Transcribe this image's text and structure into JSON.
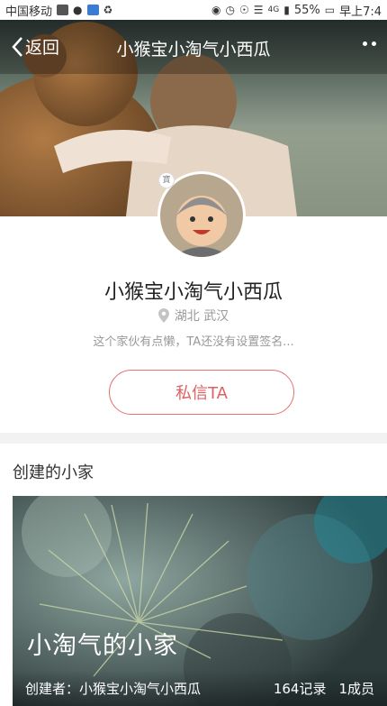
{
  "status_bar": {
    "carrier": "中国移动",
    "network": "4G",
    "battery": "55%",
    "time": "早上7:4"
  },
  "nav": {
    "back_label": "返回",
    "title": "小猴宝小淘气小西瓜"
  },
  "profile": {
    "badge": "寶",
    "name": "小猴宝小淘气小西瓜",
    "location": "湖北 武汉",
    "signature": "这个家伙有点懒，TA还没有设置签名...",
    "message_button": "私信TA"
  },
  "created_homes": {
    "section_title": "创建的小家",
    "items": [
      {
        "name": "小淘气的小家",
        "creator_label": "创建者：",
        "creator": "小猴宝小淘气小西瓜",
        "records": "164记录",
        "members": "1成员"
      }
    ]
  },
  "colors": {
    "accent": "#e57373",
    "text_primary": "#222222",
    "text_secondary": "#999999"
  }
}
